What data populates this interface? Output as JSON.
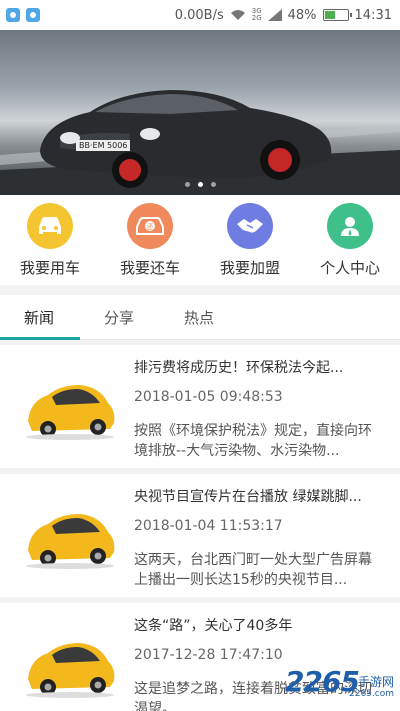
{
  "status_bar": {
    "speed": "0.00B/s",
    "network_top": "3G",
    "network_bottom": "2G",
    "battery": "48%",
    "battery_level": 0.48,
    "time": "14:31"
  },
  "banner": {
    "plate": "BB·EM 5006",
    "slide_count": 3,
    "active_slide": 1
  },
  "actions": [
    {
      "label": "我要用车",
      "icon": "car-icon",
      "color": "#f5c531"
    },
    {
      "label": "我要还车",
      "icon": "return-car-icon",
      "color": "#f08a5d"
    },
    {
      "label": "我要加盟",
      "icon": "handshake-icon",
      "color": "#6f7de3"
    },
    {
      "label": "个人中心",
      "icon": "user-icon",
      "color": "#3fc08a"
    }
  ],
  "tabs": [
    {
      "label": "新闻",
      "active": true
    },
    {
      "label": "分享",
      "active": false
    },
    {
      "label": "热点",
      "active": false
    }
  ],
  "news": [
    {
      "title": "排污费将成历史！环保税法今起...",
      "time": "2018-01-05 09:48:53",
      "summary": "按照《环境保护税法》规定，直接向环境排放--大气污染物、水污染物..."
    },
    {
      "title": "央视节目宣传片在台播放 绿媒跳脚...",
      "time": "2018-01-04 11:53:17",
      "summary": "这两天，台北西门町一处大型广告屏幕上播出一则长达15秒的央视节目..."
    },
    {
      "title": "这条“路”，关心了40多年",
      "time": "2017-12-28 17:47:10",
      "summary": "这是追梦之路，连接着脱贫致富的深切渴望。..."
    }
  ],
  "watermark": {
    "number": "2265",
    "text": "手游网",
    "sub": "2265.com"
  },
  "colors": {
    "accent": "#1aa3a0",
    "thumb_car": "#f2b81c"
  }
}
